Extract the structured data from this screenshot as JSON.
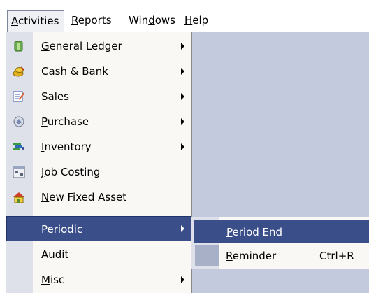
{
  "menubar": {
    "activities": {
      "pre": "",
      "u": "A",
      "post": "ctivities"
    },
    "reports": {
      "pre": "",
      "u": "R",
      "post": "eports"
    },
    "windows": {
      "pre": "Win",
      "u": "d",
      "post": "ows"
    },
    "help": {
      "pre": "",
      "u": "H",
      "post": "elp"
    }
  },
  "activities_menu": {
    "items": [
      {
        "pre": "",
        "u": "G",
        "post": "eneral Ledger",
        "submenu": true,
        "icon": "ledger-icon"
      },
      {
        "pre": "",
        "u": "C",
        "post": "ash & Bank",
        "submenu": true,
        "icon": "cash-bank-icon"
      },
      {
        "pre": "",
        "u": "S",
        "post": "ales",
        "submenu": true,
        "icon": "sales-icon"
      },
      {
        "pre": "",
        "u": "P",
        "post": "urchase",
        "submenu": true,
        "icon": "purchase-icon"
      },
      {
        "pre": "",
        "u": "I",
        "post": "nventory",
        "submenu": true,
        "icon": "inventory-icon"
      },
      {
        "pre": "",
        "u": "J",
        "post": "ob Costing",
        "submenu": false,
        "icon": "job-costing-icon"
      },
      {
        "pre": "",
        "u": "N",
        "post": "ew Fixed Asset",
        "submenu": false,
        "icon": "fixed-asset-icon"
      },
      {
        "pre": "Pe",
        "u": "r",
        "post": "iodic",
        "submenu": true,
        "icon": ""
      },
      {
        "pre": "A",
        "u": "u",
        "post": "dit",
        "submenu": false,
        "icon": ""
      },
      {
        "pre": "",
        "u": "M",
        "post": "isc",
        "submenu": true,
        "icon": ""
      }
    ],
    "highlighted_index": 7
  },
  "periodic_submenu": {
    "items": [
      {
        "pre": "",
        "u": "P",
        "post": "eriod End",
        "shortcut": ""
      },
      {
        "pre": "",
        "u": "R",
        "post": "eminder",
        "shortcut": "Ctrl+R"
      }
    ],
    "highlighted_index": 0
  },
  "colors": {
    "highlight": "#3a4f8a",
    "workspace": "#c3cadd",
    "menu_bg": "#f9f8f4",
    "gutter": "#dfe1ea"
  }
}
